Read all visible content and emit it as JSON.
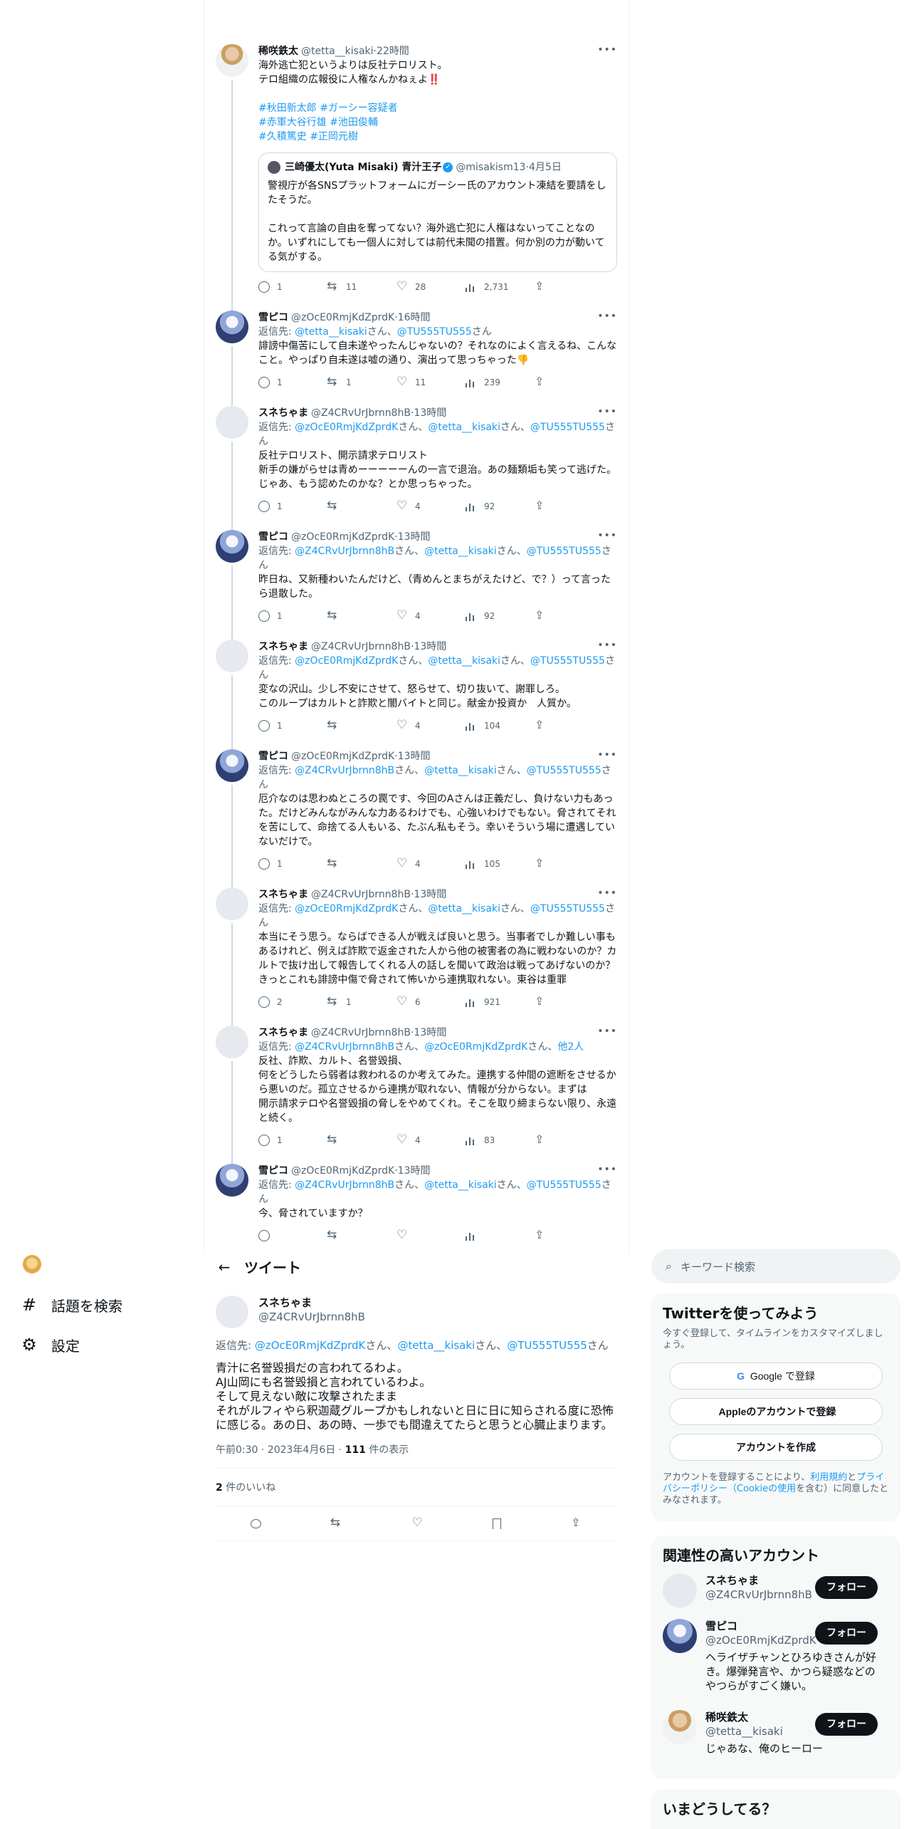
{
  "timeline": {
    "root": {
      "name": "稀咲鉄太",
      "handle": "@tetta__kisaki",
      "time": "22時間",
      "text": "海外逃亡犯というよりは反社テロリスト。\nテロ組織の広報役に人権なんかねぇよ‼️",
      "hashtags": [
        "#秋田新太郎",
        "#ガーシー容疑者",
        "#赤軍大谷行雄",
        "#池田俊輔",
        "#久積篤史",
        "#正岡元樹"
      ],
      "quote": {
        "name": "三崎優太(Yuta Misaki) 青汁王子",
        "handle": "@misakism13",
        "time": "4月5日",
        "text": "警視庁が各SNSプラットフォームにガーシー氏のアカウント凍結を要請をしたそうだ。\n\nこれって言論の自由を奪ってない？海外逃亡犯に人権はないってことなのか。いずれにしても一個人に対しては前代未聞の措置。何か別の力が動いてる気がする。"
      },
      "stats": {
        "replies": "1",
        "retweets": "11",
        "likes": "28",
        "views": "2,731"
      }
    },
    "replies": [
      {
        "name": "雪ピコ",
        "handle": "@zOcE0RmjKdZprdK",
        "time": "16時間",
        "avatar": "snow",
        "reply_to": [
          "@tetta__kisaki",
          "@TU555TU555"
        ],
        "reply_extra": "",
        "text": "誹謗中傷苦にして自未遂やったんじゃないの？それなのによく言えるね、こんなこと。やっぱり自未遂は嘘の通り、演出って思っちゃった👎",
        "stats": {
          "replies": "1",
          "retweets": "1",
          "likes": "11",
          "views": "239"
        }
      },
      {
        "name": "スネちゃま",
        "handle": "@Z4CRvUrJbrnn8hB",
        "time": "13時間",
        "avatar": "fish",
        "reply_to": [
          "@zOcE0RmjKdZprdK",
          "@tetta__kisaki",
          "@TU555TU555"
        ],
        "reply_extra": "",
        "text": "反社テロリスト、開示請求テロリスト\n新手の嫌がらせは青めーーーーーんの一言で退治。あの麺類垢も笑って逃げた。\nじゃあ、もう認めたのかな？とか思っちゃった。",
        "stats": {
          "replies": "1",
          "retweets": "",
          "likes": "4",
          "views": "92"
        }
      },
      {
        "name": "雪ピコ",
        "handle": "@zOcE0RmjKdZprdK",
        "time": "13時間",
        "avatar": "snow",
        "reply_to": [
          "@Z4CRvUrJbrnn8hB",
          "@tetta__kisaki",
          "@TU555TU555"
        ],
        "reply_extra": "",
        "text": "昨日ね、又新種わいたんだけど、（青めんとまちがえたけど、で？）って言ったら退散した。",
        "stats": {
          "replies": "1",
          "retweets": "",
          "likes": "4",
          "views": "92"
        }
      },
      {
        "name": "スネちゃま",
        "handle": "@Z4CRvUrJbrnn8hB",
        "time": "13時間",
        "avatar": "fish",
        "reply_to": [
          "@zOcE0RmjKdZprdK",
          "@tetta__kisaki",
          "@TU555TU555"
        ],
        "reply_extra": "",
        "text": "変なの沢山。少し不安にさせて、怒らせて、切り抜いて、謝罪しろ。\nこのループはカルトと詐欺と闇バイトと同じ。献金か投資か　人質か。",
        "stats": {
          "replies": "1",
          "retweets": "",
          "likes": "4",
          "views": "104"
        }
      },
      {
        "name": "雪ピコ",
        "handle": "@zOcE0RmjKdZprdK",
        "time": "13時間",
        "avatar": "snow",
        "reply_to": [
          "@Z4CRvUrJbrnn8hB",
          "@tetta__kisaki",
          "@TU555TU555"
        ],
        "reply_extra": "",
        "text": "厄介なのは思わぬところの罠です、今回のAさんは正義だし、負けない力もあった。だけどみんながみんな力あるわけでも、心強いわけでもない。脅されてそれを苦にして、命捨てる人もいる、たぶん私もそう。幸いそういう場に遭遇していないだけで。",
        "stats": {
          "replies": "1",
          "retweets": "",
          "likes": "4",
          "views": "105"
        }
      },
      {
        "name": "スネちゃま",
        "handle": "@Z4CRvUrJbrnn8hB",
        "time": "13時間",
        "avatar": "fish",
        "reply_to": [
          "@zOcE0RmjKdZprdK",
          "@tetta__kisaki",
          "@TU555TU555"
        ],
        "reply_extra": "",
        "text": "本当にそう思う。ならばできる人が戦えば良いと思う。当事者でしか難しい事もあるけれど、例えば詐欺で返金された人から他の被害者の為に戦わないのか？カルトで抜け出して報告してくれる人の話しを聞いて政治は戦ってあげないのか？\nきっとこれも誹謗中傷で脅されて怖いから連携取れない。東谷は重罪",
        "stats": {
          "replies": "2",
          "retweets": "1",
          "likes": "6",
          "views": "921"
        }
      },
      {
        "name": "スネちゃま",
        "handle": "@Z4CRvUrJbrnn8hB",
        "time": "13時間",
        "avatar": "fish",
        "reply_to": [
          "@Z4CRvUrJbrnn8hB",
          "@zOcE0RmjKdZprdK"
        ],
        "reply_extra": "他2人",
        "text": "反社、詐欺、カルト、名誉毀損、\n何をどうしたら弱者は救われるのか考えてみた。連携する仲間の遮断をさせるから悪いのだ。孤立させるから連携が取れない、情報が分からない。まずは\n開示請求テロや名誉毀損の脅しをやめてくれ。そこを取り締まらない限り、永遠と続く。",
        "stats": {
          "replies": "1",
          "retweets": "",
          "likes": "4",
          "views": "83"
        }
      },
      {
        "name": "雪ピコ",
        "handle": "@zOcE0RmjKdZprdK",
        "time": "13時間",
        "avatar": "snow",
        "reply_to": [
          "@Z4CRvUrJbrnn8hB",
          "@tetta__kisaki",
          "@TU555TU555"
        ],
        "reply_extra": "",
        "text": "今、脅されていますか？",
        "stats": {
          "replies": "",
          "retweets": "",
          "likes": "",
          "views": ""
        }
      }
    ]
  },
  "nav": {
    "items": [
      {
        "label": "話題を検索",
        "icon": "hashtag-icon"
      },
      {
        "label": "設定",
        "icon": "gear-icon"
      }
    ]
  },
  "main": {
    "header_title": "ツイート",
    "name": "スネちゃま",
    "handle": "@Z4CRvUrJbrnn8hB",
    "reply_prefix": "返信先: ",
    "reply_to": [
      "@zOcE0RmjKdZprdK",
      "@tetta__kisaki",
      "@TU555TU555"
    ],
    "san": "さん",
    "text": "青汁に名誉毀損だの言われてるわよ。\nAJ山岡にも名誉毀損と言われているわよ。\nそして見えない敵に攻撃されたまま\nそれがルフィやら釈迦蔵グループかもしれないと日に日に知らされる度に恐怖に感じる。あの日、あの時、一歩でも間違えてたらと思うと心臓止まります。",
    "timestamp": "午前0:30 · 2023年4月6日 · ",
    "views_count": "111",
    "views_label": " 件の表示",
    "likes_count": "2",
    "likes_label": " 件のいいね"
  },
  "right": {
    "search_placeholder": "キーワード検索",
    "signup": {
      "title": "Twitterを使ってみよう",
      "desc": "今すぐ登録して、タイムラインをカスタマイズしましょう。",
      "google": "Google で登録",
      "apple": "Appleのアカウントで登録",
      "create": "アカウントを作成",
      "legal_pre": "アカウントを登録することにより、",
      "legal_terms": "利用規約",
      "legal_and": "と",
      "legal_privacy": "プライバシーポリシー（Cookieの使用",
      "legal_post": "を含む）に同意したとみなされます。"
    },
    "related": {
      "title": "関連性の高いアカウント",
      "follow_label": "フォロー",
      "accounts": [
        {
          "name": "スネちゃま",
          "handle": "@Z4CRvUrJbrnn8hB",
          "bio": ""
        },
        {
          "name": "雪ピコ",
          "handle": "@zOcE0RmjKdZprdK",
          "bio": "ヘライザチャンとひろゆきさんが好き。爆弾発言や、かつら疑惑などのやつらがすごく嫌い。"
        },
        {
          "name": "稀咲鉄太",
          "handle": "@tetta__kisaki",
          "bio": "じゃあな、俺のヒーロー"
        }
      ]
    },
    "trends_title": "いまどうしてる？"
  },
  "labels": {
    "reply_prefix": "返信先: ",
    "san": "さん",
    "sep": "、",
    "dot": " · "
  }
}
